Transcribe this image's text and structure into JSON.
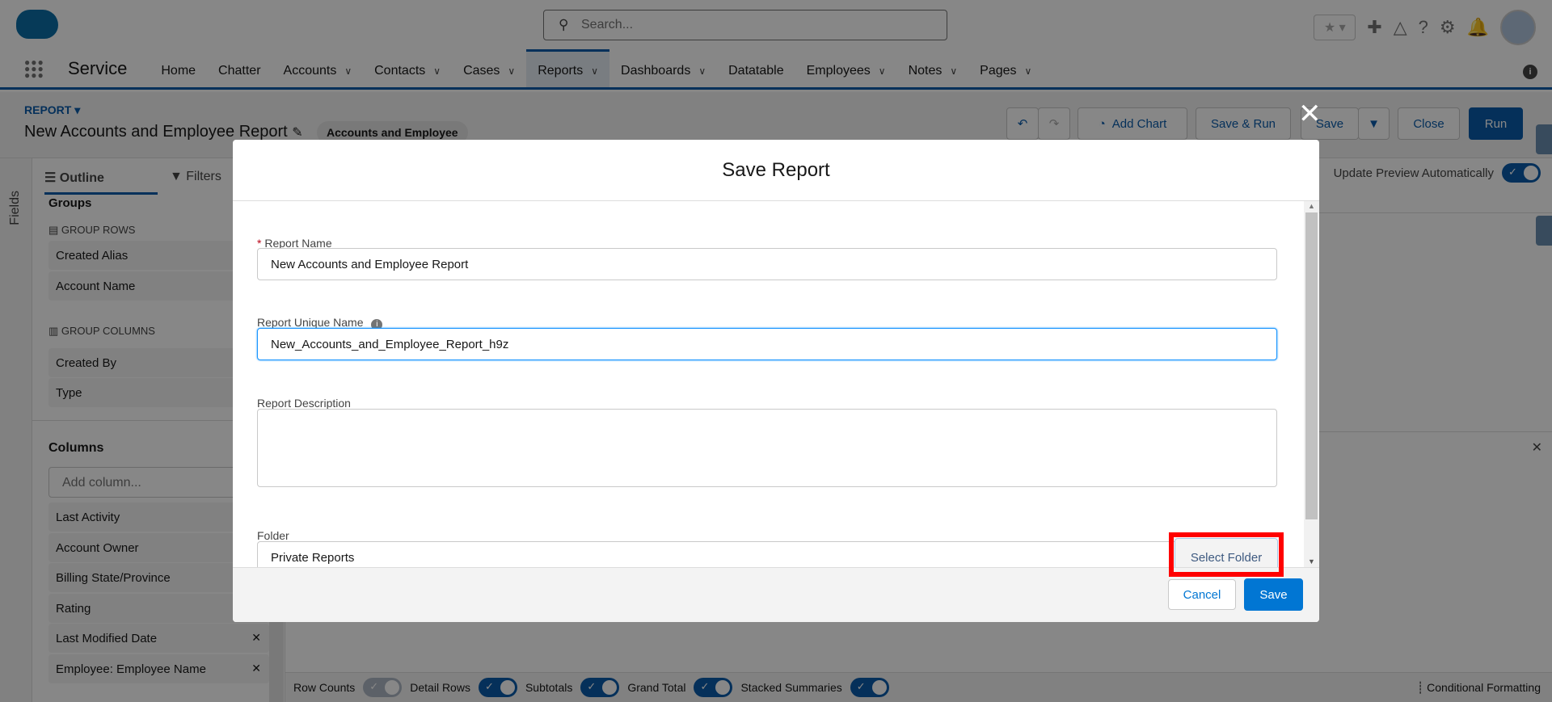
{
  "header": {
    "search_placeholder": "Search...",
    "icons": [
      "favorites-star-icon",
      "add-icon",
      "trailhead-icon",
      "help-icon",
      "setup-gear-icon",
      "notification-bell-icon",
      "avatar"
    ]
  },
  "nav": {
    "app_name": "Service",
    "items": [
      {
        "label": "Home",
        "chevron": false
      },
      {
        "label": "Chatter",
        "chevron": false
      },
      {
        "label": "Accounts",
        "chevron": true
      },
      {
        "label": "Contacts",
        "chevron": true
      },
      {
        "label": "Cases",
        "chevron": true
      },
      {
        "label": "Reports",
        "chevron": true,
        "active": true
      },
      {
        "label": "Dashboards",
        "chevron": true
      },
      {
        "label": "Datatable",
        "chevron": false
      },
      {
        "label": "Employees",
        "chevron": true
      },
      {
        "label": "Notes",
        "chevron": true
      },
      {
        "label": "Pages",
        "chevron": true
      }
    ]
  },
  "report": {
    "label": "REPORT",
    "title": "New Accounts and Employee Report",
    "type": "Accounts and Employee",
    "buttons": {
      "add_chart": "Add Chart",
      "save_run": "Save & Run",
      "save": "Save",
      "close": "Close",
      "run": "Run"
    },
    "update_preview": "Update Preview Automatically"
  },
  "left": {
    "fields_label": "Fields",
    "tabs": {
      "outline": "Outline",
      "filters": "Filters"
    },
    "groups": "Groups",
    "group_rows": "GROUP ROWS",
    "group_row_items": [
      "Created Alias",
      "Account Name"
    ],
    "group_columns": "GROUP COLUMNS",
    "group_column_items": [
      "Created By",
      "Type"
    ],
    "columns": "Columns",
    "add_column_placeholder": "Add column...",
    "column_items": [
      "Last Activity",
      "Account Owner",
      "Billing State/Province",
      "Rating",
      "Last Modified Date",
      "Employee: Employee Name"
    ]
  },
  "bottom": {
    "toggles": [
      {
        "label": "Row Counts",
        "on": false
      },
      {
        "label": "Detail Rows",
        "on": true
      },
      {
        "label": "Subtotals",
        "on": true
      },
      {
        "label": "Grand Total",
        "on": true
      },
      {
        "label": "Stacked Summaries",
        "on": true
      }
    ],
    "conditional_formatting": "Conditional Formatting"
  },
  "modal": {
    "title": "Save Report",
    "report_name_label": "Report Name",
    "report_name": "New Accounts and Employee Report",
    "unique_name_label": "Report Unique Name",
    "unique_name": "New_Accounts_and_Employee_Report_h9z",
    "description_label": "Report Description",
    "description": "",
    "folder_label": "Folder",
    "folder": "Private Reports",
    "select_folder": "Select Folder",
    "cancel": "Cancel",
    "save": "Save"
  },
  "colors": {
    "brand": "#0b5cab",
    "save_button": "#0176d3",
    "highlight": "#ff0000"
  }
}
